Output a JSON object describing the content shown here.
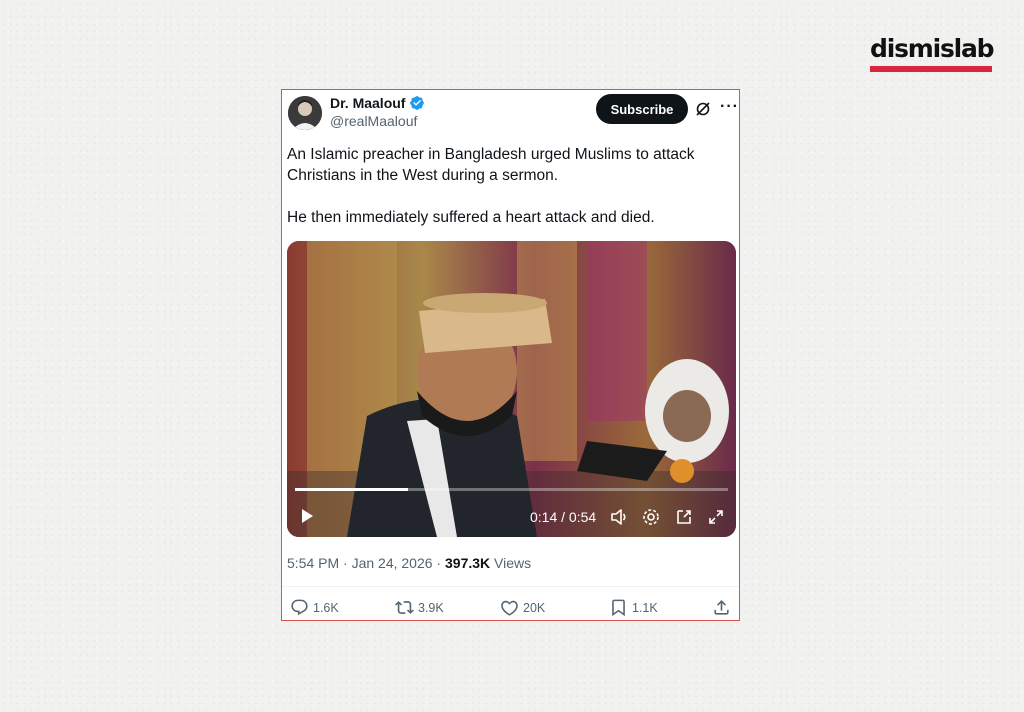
{
  "brand": {
    "name": "dismislab",
    "accent_color": "#d7263d"
  },
  "tweet": {
    "author": {
      "display_name": "Dr. Maalouf",
      "handle": "@realMaalouf",
      "verified": true,
      "avatar_icon": "avatar-photo"
    },
    "subscribe_label": "Subscribe",
    "grok_icon": "grok-icon",
    "more_icon": "more-horizontal-icon",
    "more_label": "···",
    "text": [
      "An Islamic preacher in Bangladesh urged Muslims to attack Christians in the West during a sermon.",
      "He then immediately suffered a heart attack and died."
    ],
    "video": {
      "current_time": "0:14",
      "duration": "0:54",
      "time_display": "0:14 / 0:54",
      "progress_fraction": 0.26,
      "controls": [
        "play-icon",
        "volume-icon",
        "settings-icon",
        "pip-icon",
        "fullscreen-icon"
      ]
    },
    "timestamp": "5:54 PM · Jan 24, 2026",
    "separator": " · ",
    "views_count": "397.3K",
    "views_label": " Views",
    "actions": {
      "replies": "1.6K",
      "reposts": "3.9K",
      "likes": "20K",
      "bookmarks": "1.1K"
    }
  }
}
